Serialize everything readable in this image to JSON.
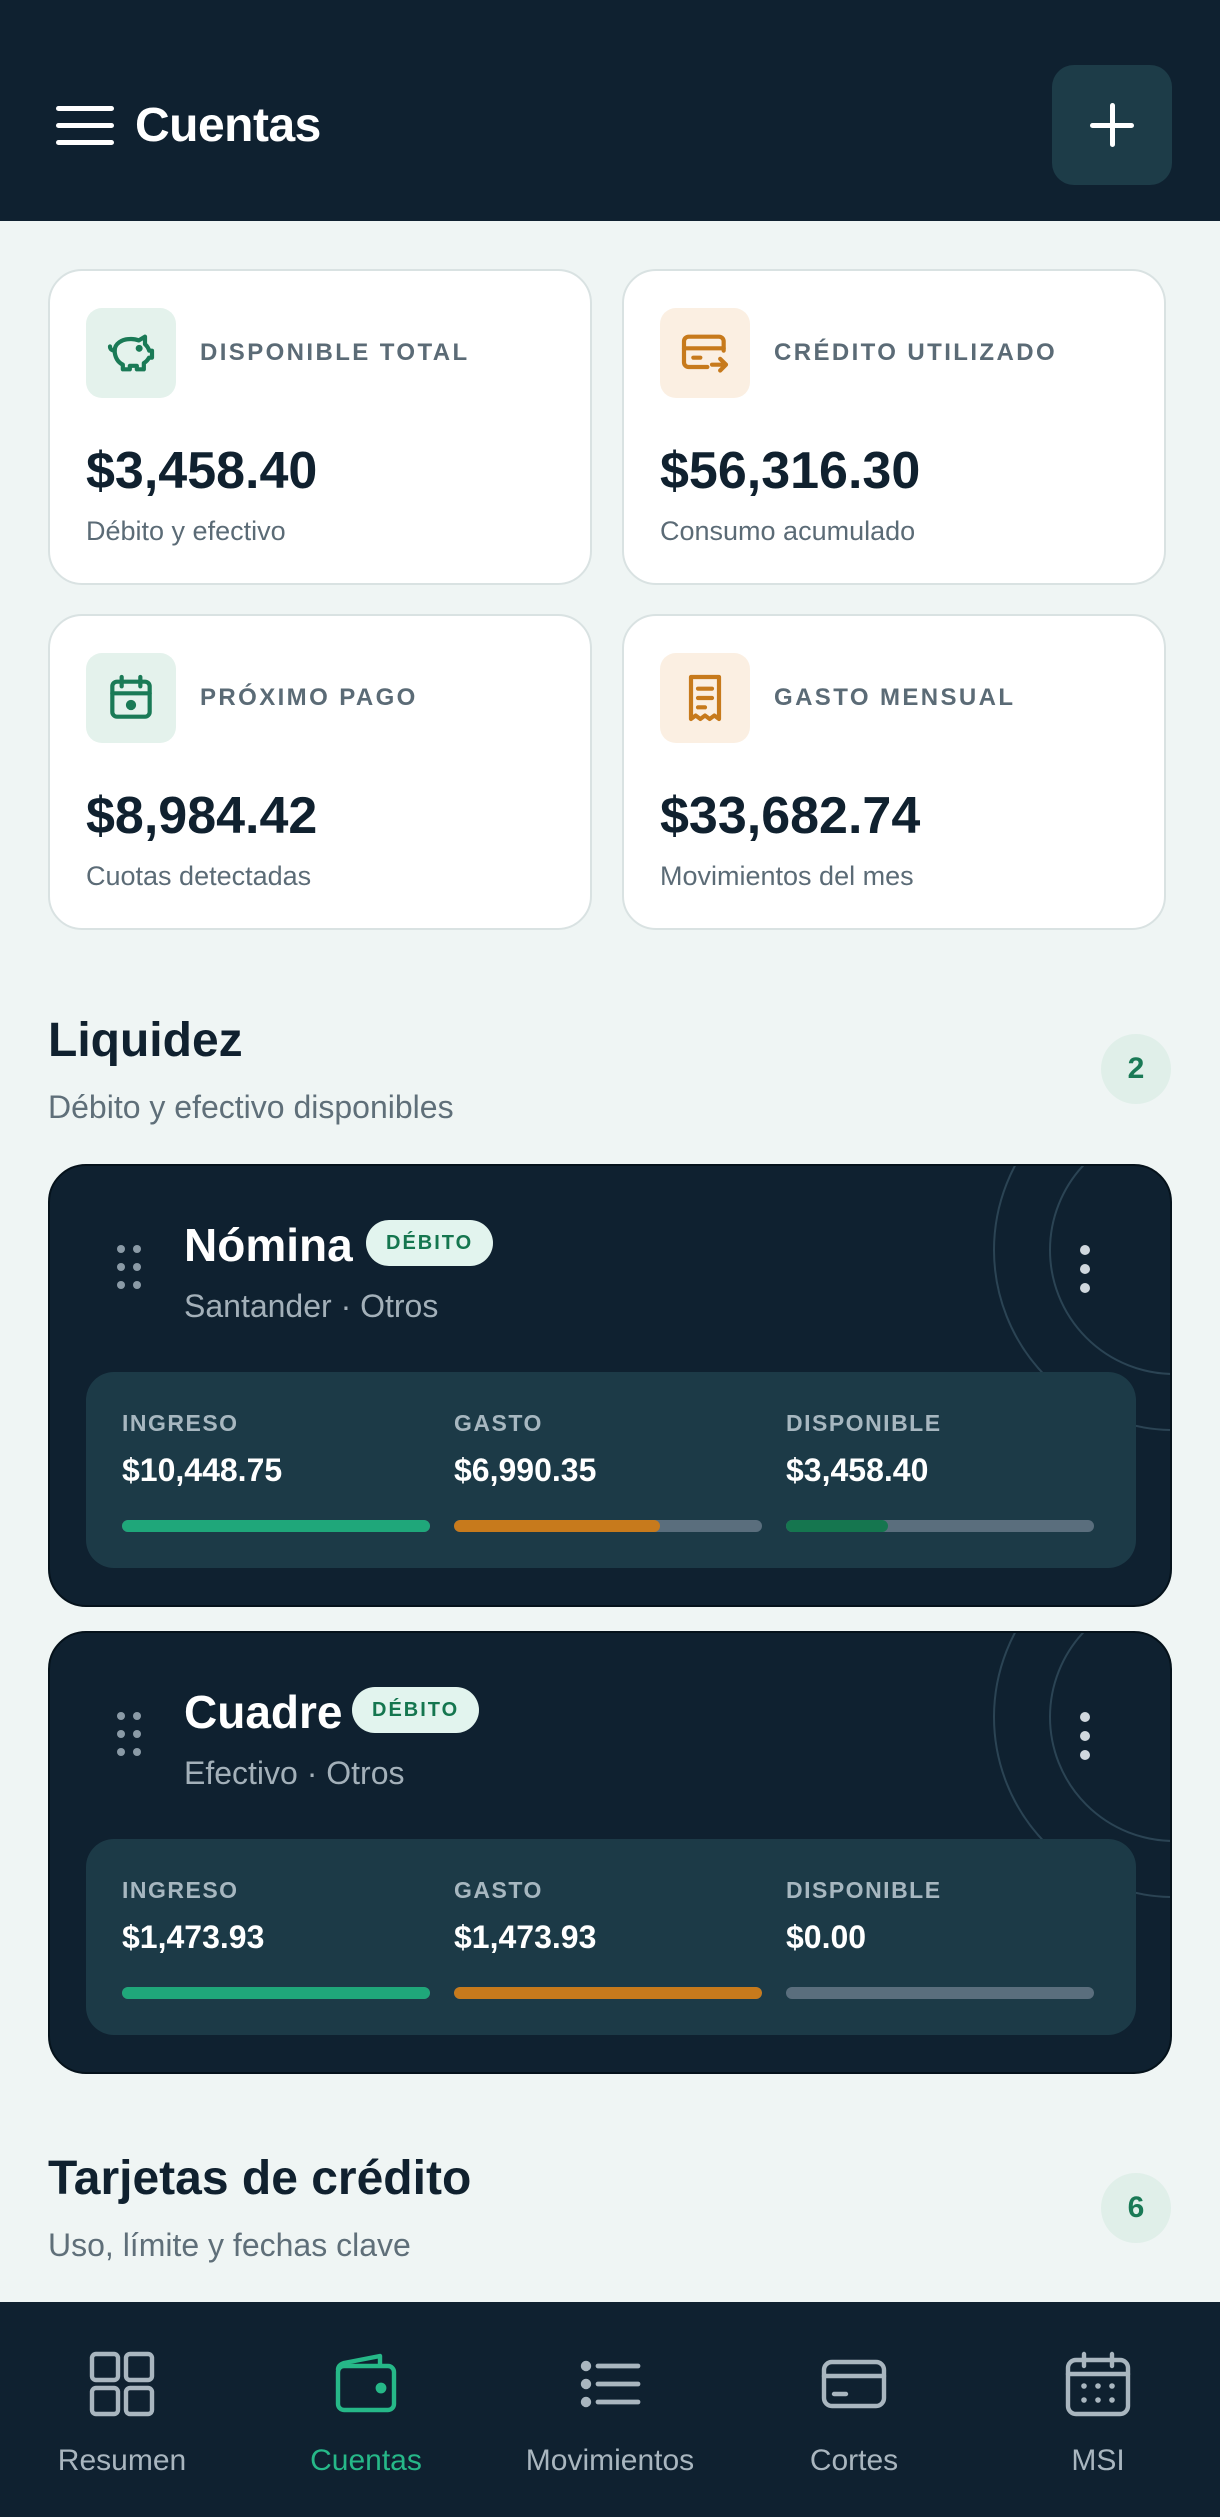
{
  "header": {
    "title": "Cuentas"
  },
  "summary_cards": [
    {
      "label": "DISPONIBLE TOTAL",
      "value": "$3,458.40",
      "sub": "Débito y efectivo",
      "icon": "piggy-bank-icon"
    },
    {
      "label": "CRÉDITO UTILIZADO",
      "value": "$56,316.30",
      "sub": "Consumo acumulado",
      "icon": "credit-card-icon"
    },
    {
      "label": "PRÓXIMO PAGO",
      "value": "$8,984.42",
      "sub": "Cuotas detectadas",
      "icon": "calendar-icon"
    },
    {
      "label": "GASTO MENSUAL",
      "value": "$33,682.74",
      "sub": "Movimientos del mes",
      "icon": "receipt-icon"
    }
  ],
  "liquidez": {
    "title": "Liquidez",
    "subtitle": "Débito y efectivo disponibles",
    "count": "2"
  },
  "accounts": [
    {
      "name": "Nómina",
      "badge": "DÉBITO",
      "meta": "Santander · Otros",
      "stats": [
        {
          "label": "INGRESO",
          "value": "$10,448.75",
          "fill": 1.0
        },
        {
          "label": "GASTO",
          "value": "$6,990.35",
          "fill": 0.67
        },
        {
          "label": "DISPONIBLE",
          "value": "$3,458.40",
          "fill": 0.33
        }
      ]
    },
    {
      "name": "Cuadre",
      "badge": "DÉBITO",
      "meta": "Efectivo · Otros",
      "stats": [
        {
          "label": "INGRESO",
          "value": "$1,473.93",
          "fill": 1.0
        },
        {
          "label": "GASTO",
          "value": "$1,473.93",
          "fill": 1.0
        },
        {
          "label": "DISPONIBLE",
          "value": "$0.00",
          "fill": 0.0
        }
      ]
    }
  ],
  "tarjetas": {
    "title": "Tarjetas de crédito",
    "subtitle": "Uso, límite y fechas clave",
    "count": "6"
  },
  "nav": [
    {
      "label": "Resumen",
      "icon": "grid-icon",
      "active": false
    },
    {
      "label": "Cuentas",
      "icon": "wallet-icon",
      "active": true
    },
    {
      "label": "Movimientos",
      "icon": "list-icon",
      "active": false
    },
    {
      "label": "Cortes",
      "icon": "card-icon",
      "active": false
    },
    {
      "label": "MSI",
      "icon": "calendar-grid-icon",
      "active": false
    }
  ],
  "colors": {
    "dark": "#0f2130",
    "panel": "#1c3a47",
    "green": "#1fa77a",
    "orange": "#c77a1c",
    "dark_green": "#15764f",
    "bar_track": "#5a6e7d",
    "nav_active": "#26b888"
  }
}
